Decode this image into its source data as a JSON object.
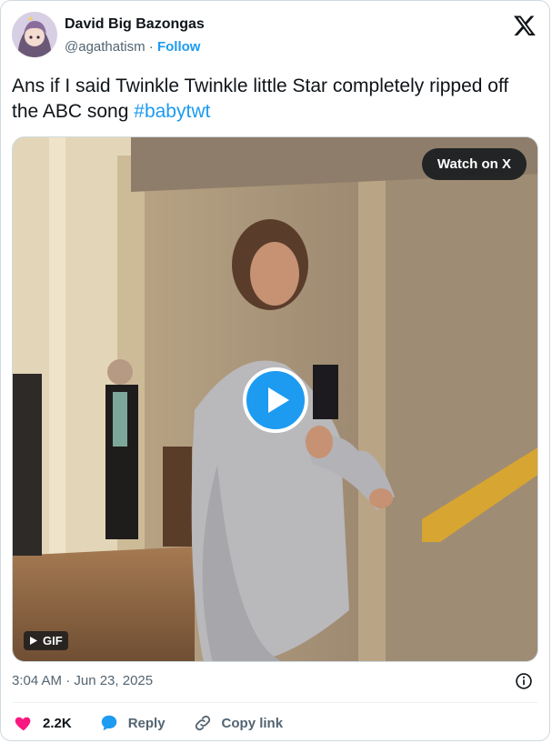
{
  "author": {
    "display_name": "David Big Bazongas",
    "handle": "@agathatism",
    "separator": "·",
    "follow_label": "Follow"
  },
  "brand_icon": "x-logo-icon",
  "tweet": {
    "text": "Ans if I said Twinkle Twinkle little Star completely ripped off the ABC song ",
    "hashtag": "#babytwt"
  },
  "media": {
    "watch_label": "Watch on X",
    "gif_label": "GIF",
    "play_icon": "play-icon"
  },
  "meta": {
    "timestamp": "3:04 AM · Jun 23, 2025",
    "info_icon": "info-icon"
  },
  "actions": {
    "like_count": "2.2K",
    "reply_label": "Reply",
    "copy_link_label": "Copy link"
  },
  "colors": {
    "accent": "#1d9bf0",
    "like": "#f91880",
    "text_primary": "#0f1419",
    "text_secondary": "#536471"
  }
}
